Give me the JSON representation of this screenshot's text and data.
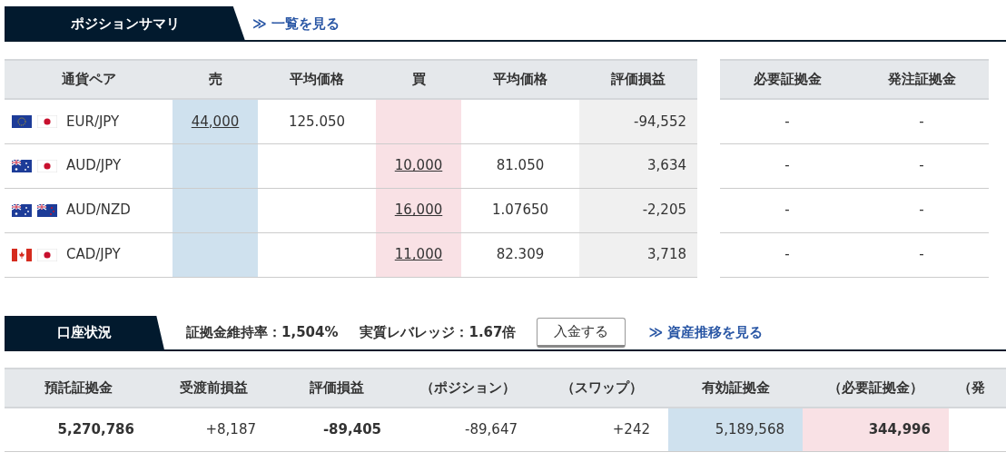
{
  "position_summary": {
    "title": "ポジションサマリ",
    "link": "≫ 一覧を見る",
    "columns": [
      "通貨ペア",
      "売",
      "平均価格",
      "買",
      "平均価格",
      "評価損益"
    ],
    "rows": [
      {
        "pair": "EUR/JPY",
        "flags": [
          {
            "kind": "eu"
          },
          {
            "kind": "jp"
          }
        ],
        "sell": "44,000",
        "sell_avg": "125.050",
        "pnl": "-94,552"
      },
      {
        "pair": "AUD/JPY",
        "flags": [
          {
            "kind": "au"
          },
          {
            "kind": "jp"
          }
        ],
        "buy": "10,000",
        "buy_avg": "81.050",
        "pnl": "3,634"
      },
      {
        "pair": "AUD/NZD",
        "flags": [
          {
            "kind": "au"
          },
          {
            "kind": "nz"
          }
        ],
        "buy": "16,000",
        "buy_avg": "1.07650",
        "pnl": "-2,205"
      },
      {
        "pair": "CAD/JPY",
        "flags": [
          {
            "kind": "ca"
          },
          {
            "kind": "jp"
          }
        ],
        "buy": "11,000",
        "buy_avg": "82.309",
        "pnl": "3,718"
      }
    ],
    "margin_columns": [
      "必要証拠金",
      "発注証拠金"
    ],
    "margin_rows": [
      [
        "-",
        "-"
      ],
      [
        "-",
        "-"
      ],
      [
        "-",
        "-"
      ],
      [
        "-",
        "-"
      ]
    ]
  },
  "account_status": {
    "title": "口座状況",
    "maintenance_rate": "証拠金維持率：1,504%",
    "leverage": "実質レバレッジ：1.67倍",
    "deposit_button": "入金する",
    "link": "≫ 資産推移を見る",
    "columns": [
      "預託証拠金",
      "受渡前損益",
      "評価損益",
      "（ポジション）",
      "（スワップ）",
      "有効証拠金",
      "（必要証拠金）",
      "（発"
    ],
    "values": [
      {
        "value": "5,270,786",
        "bold": true
      },
      {
        "value": "+8,187",
        "bold": false
      },
      {
        "value": "-89,405",
        "bold": true
      },
      {
        "value": "-89,647",
        "bold": false
      },
      {
        "value": "+242",
        "bold": false
      },
      {
        "value": "5,189,568",
        "bold": false,
        "color": "#cfe1ee"
      },
      {
        "value": "344,996",
        "bold": true,
        "color": "#f9e1e5"
      }
    ]
  }
}
